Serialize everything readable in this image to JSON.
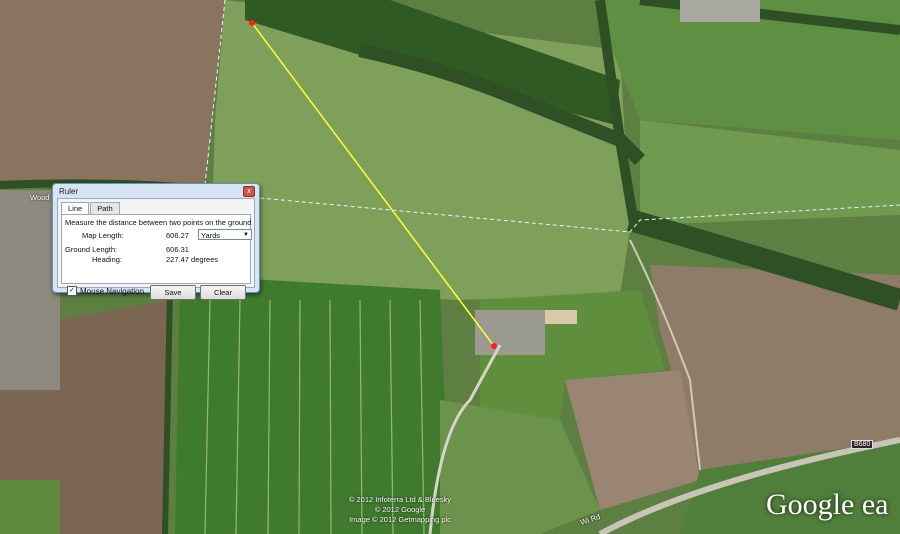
{
  "map": {
    "colors": {
      "field_light": "#7fa05a",
      "field_mid": "#6b8f4a",
      "field_dark": "#3f6a2a",
      "plowed": "#8a7460",
      "trees": "#2f4f25",
      "measure_line": "#ffff33",
      "border_line": "#e8f4ff"
    },
    "road_labels": [
      "Wood",
      "B680",
      "Wi Rd"
    ]
  },
  "ruler": {
    "title": "Ruler",
    "close_glyph": "x",
    "tabs": [
      {
        "label": "Line",
        "active": true
      },
      {
        "label": "Path",
        "active": false
      }
    ],
    "description": "Measure the distance between two points on the ground",
    "map_length_label": "Map Length:",
    "map_length_value": "606.27",
    "units": "Yards",
    "ground_length_label": "Ground Length:",
    "ground_length_value": "606.31",
    "heading_label": "Heading:",
    "heading_value": "227.47 degrees",
    "mouse_navigation_label": "Mouse Navigation",
    "mouse_navigation_checked": true,
    "save_label": "Save",
    "clear_label": "Clear"
  },
  "credits": {
    "line1": "© 2012 Infoterra Ltd & Bluesky",
    "line2": "© 2012 Google",
    "line3": "Image © 2012 Getmapping plc"
  },
  "logo": "Google ea"
}
